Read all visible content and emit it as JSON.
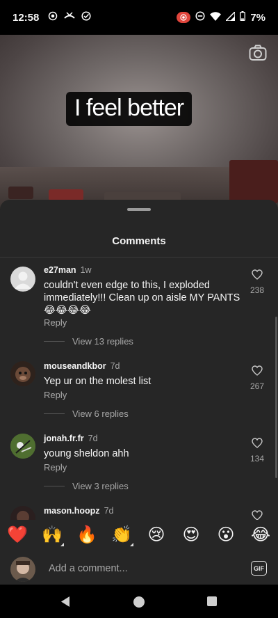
{
  "status": {
    "time": "12:58",
    "battery": "7%",
    "icons": [
      "location-icon",
      "missed-call-icon",
      "check-circle-icon",
      "screen-record-icon",
      "do-not-disturb-icon",
      "wifi-icon",
      "signal-icon",
      "battery-icon"
    ]
  },
  "video": {
    "caption": "I feel better",
    "icon": "camera-icon"
  },
  "sheet": {
    "title": "Comments"
  },
  "comments": [
    {
      "user": "e27man",
      "time": "1w",
      "text": "couldn't even edge to this, I exploded immediately!!! Clean up on aisle MY PANTS 😂😂😂😂",
      "reply": "Reply",
      "view_replies": "View 13 replies",
      "likes": "238"
    },
    {
      "user": "mouseandkbor",
      "time": "7d",
      "text": "Yep ur on the molest list",
      "reply": "Reply",
      "view_replies": "View 6 replies",
      "likes": "267"
    },
    {
      "user": "jonah.fr.fr",
      "time": "7d",
      "text": "young sheldon ahh",
      "reply": "Reply",
      "view_replies": "View 3 replies",
      "likes": "134"
    },
    {
      "user": "mason.hoopz",
      "time": "7d"
    }
  ],
  "emojis": [
    "❤️",
    "🙌",
    "🔥",
    "👏",
    "😢",
    "😍",
    "😮",
    "😂"
  ],
  "composer": {
    "placeholder": "Add a comment...",
    "gif_label": "GIF"
  },
  "nav": {
    "icons": [
      "back-icon",
      "home-icon",
      "recents-icon"
    ]
  }
}
